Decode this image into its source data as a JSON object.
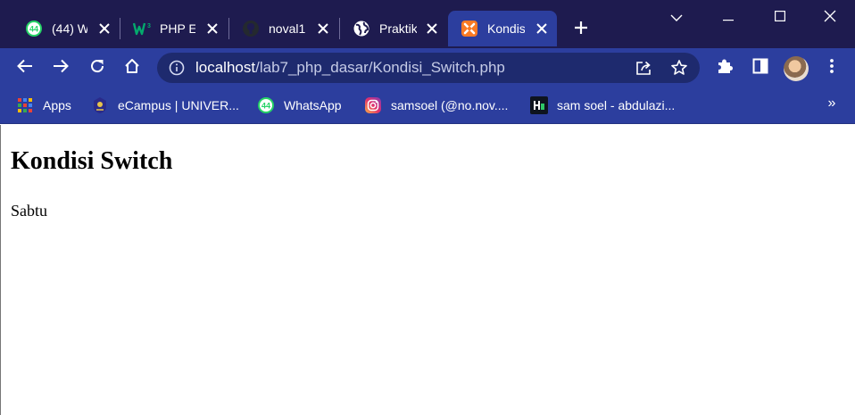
{
  "browser": {
    "tabs": [
      {
        "label": "(44) W",
        "icon": "whatsapp-icon",
        "badge": "44"
      },
      {
        "label": "PHP Ec",
        "icon": "w3schools-icon"
      },
      {
        "label": "noval1",
        "icon": "github-icon"
      },
      {
        "label": "Praktik",
        "icon": "globe-icon"
      },
      {
        "label": "Kondis",
        "icon": "xampp-icon",
        "active": true
      }
    ],
    "address_bar": {
      "host": "localhost",
      "path": "/lab7_php_dasar/Kondisi_Switch.php"
    },
    "bookmarks": [
      {
        "label": "Apps",
        "icon": "apps-grid-icon"
      },
      {
        "label": "eCampus | UNIVER...",
        "icon": "university-icon"
      },
      {
        "label": "WhatsApp",
        "icon": "whatsapp-icon",
        "badge": "44"
      },
      {
        "label": "samsoel (@no.nov....",
        "icon": "instagram-icon"
      },
      {
        "label": "sam soel - abdulazi...",
        "icon": "hackerrank-icon"
      }
    ],
    "bookmarks_overflow": "»",
    "colors": {
      "tabstrip": "#1e1b4f",
      "toolbar": "#2c3e9e",
      "omnibox": "#1e2a6e"
    }
  },
  "page": {
    "heading": "Kondisi Switch",
    "text": "Sabtu"
  }
}
